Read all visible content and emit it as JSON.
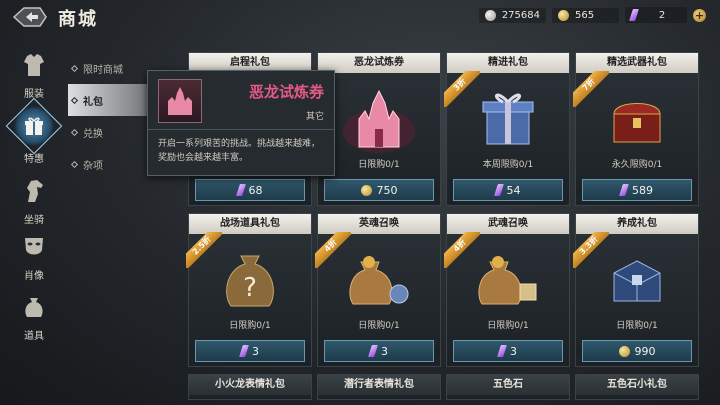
{
  "header": {
    "title": "商城",
    "currencies": {
      "silver": "275684",
      "gold": "565",
      "gems": "2"
    }
  },
  "rail": [
    {
      "label": "服装",
      "icon": "armor-icon"
    },
    {
      "label": "特惠",
      "icon": "gift-icon"
    },
    {
      "label": "坐骑",
      "icon": "horse-icon"
    },
    {
      "label": "肖像",
      "icon": "mask-icon"
    },
    {
      "label": "道具",
      "icon": "bag-icon"
    }
  ],
  "submenu": [
    {
      "label": "限时商城"
    },
    {
      "label": "礼包"
    },
    {
      "label": "兑换"
    },
    {
      "label": "杂项"
    }
  ],
  "cards": [
    {
      "name": "启程礼包",
      "limit": "",
      "price": "68",
      "currency": "gem",
      "ribbon": ""
    },
    {
      "name": "恶龙试炼券",
      "limit": "日限购0/1",
      "price": "750",
      "currency": "gold",
      "ribbon": ""
    },
    {
      "name": "精进礼包",
      "limit": "本周限购0/1",
      "price": "54",
      "currency": "gem",
      "ribbon": "3折"
    },
    {
      "name": "精选武器礼包",
      "limit": "永久限购0/1",
      "price": "589",
      "currency": "gem",
      "ribbon": "7折"
    },
    {
      "name": "战场道具礼包",
      "limit": "日限购0/1",
      "price": "3",
      "currency": "gem",
      "ribbon": "2.5折"
    },
    {
      "name": "英魂召唤",
      "limit": "日限购0/1",
      "price": "3",
      "currency": "gem",
      "ribbon": "4折"
    },
    {
      "name": "武魂召唤",
      "limit": "日限购0/1",
      "price": "3",
      "currency": "gem",
      "ribbon": "4折"
    },
    {
      "name": "养成礼包",
      "limit": "日限购0/1",
      "price": "990",
      "currency": "gold",
      "ribbon": "3.3折"
    },
    {
      "name": "小火龙表情礼包"
    },
    {
      "name": "潜行者表情礼包"
    },
    {
      "name": "五色石"
    },
    {
      "name": "五色石小礼包"
    }
  ],
  "tooltip": {
    "title": "恶龙试炼券",
    "type": "其它",
    "desc": "开启一系列艰苦的挑战。挑战越来越难，奖励也会越来越丰富。"
  },
  "colors": {
    "accent": "#e45a86",
    "price_bg": "#2b5468",
    "ribbon": "#e3a23c"
  }
}
